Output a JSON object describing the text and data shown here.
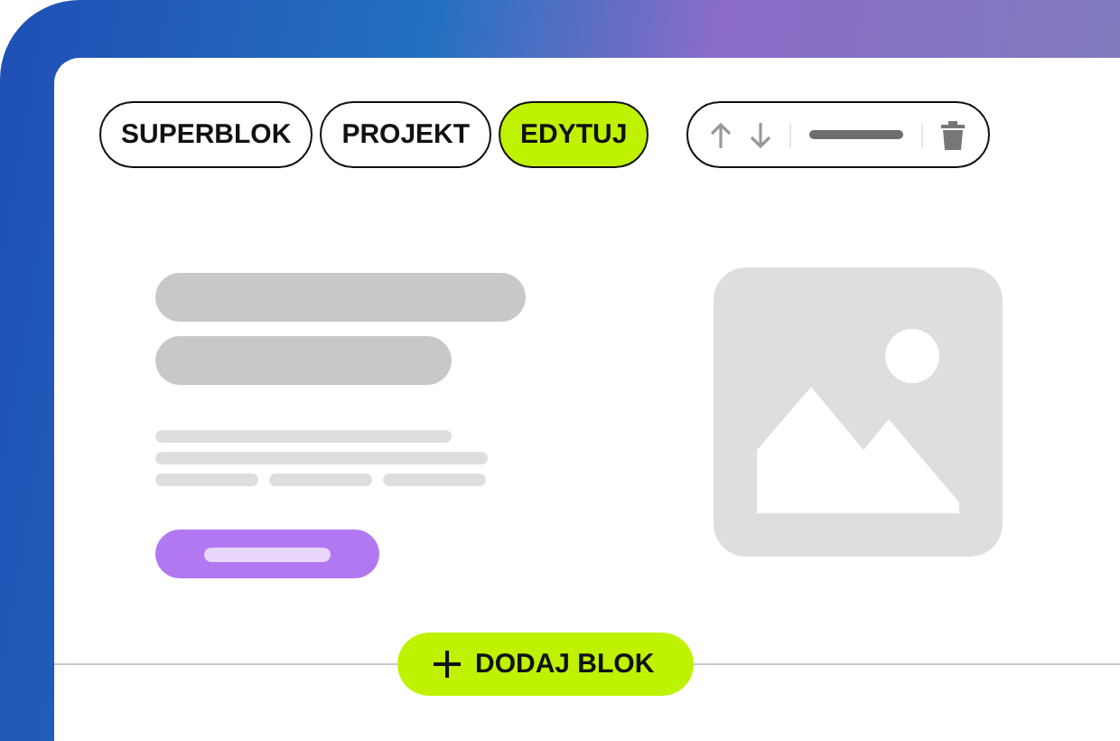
{
  "tabs": [
    {
      "label": "SUPERBLOK",
      "selected": false
    },
    {
      "label": "PROJEKT",
      "selected": false
    },
    {
      "label": "EDYTUJ",
      "selected": true
    }
  ],
  "toolbar": {
    "items": [
      {
        "kind": "up"
      },
      {
        "kind": "down"
      },
      {
        "kind": "bar"
      },
      {
        "kind": "trash"
      }
    ]
  },
  "add_button": {
    "label": "DODAJ BLOK"
  }
}
